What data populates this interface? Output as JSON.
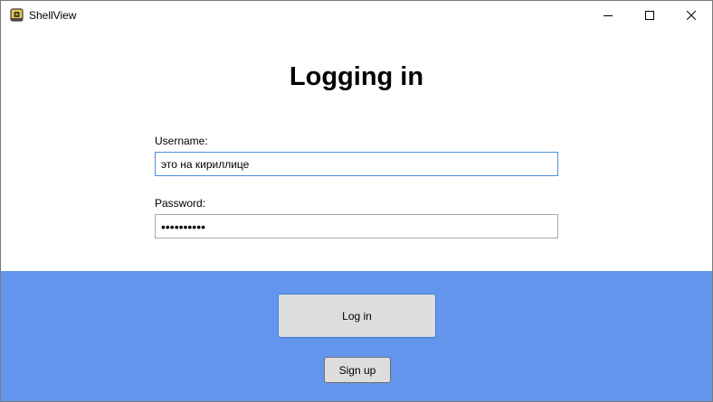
{
  "window": {
    "title": "ShellView",
    "app_icon": "lock-icon",
    "controls": {
      "minimize_icon": "minimize-icon",
      "maximize_icon": "maximize-icon",
      "close_icon": "close-icon"
    }
  },
  "login": {
    "heading": "Logging in",
    "username_label": "Username:",
    "username_value": "это на кириллице",
    "password_label": "Password:",
    "password_value": "••••••••••",
    "login_button": "Log in",
    "signup_button": "Sign up"
  },
  "colors": {
    "footer_background": "#6495ed",
    "focus_border": "#4a90d9",
    "button_background": "#dddddd"
  }
}
